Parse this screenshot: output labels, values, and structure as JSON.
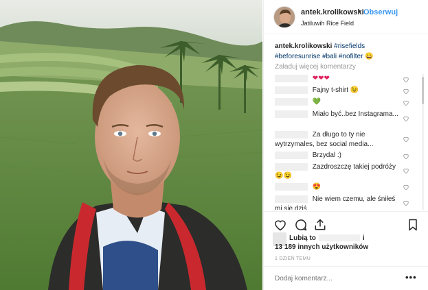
{
  "header": {
    "username": "antek.krolikowski",
    "dot": "•",
    "follow_label": "Obserwuj",
    "location": "Jatiluwih Rice Field"
  },
  "caption": {
    "username": "antek.krolikowski",
    "tag1": "#risefields",
    "tag2": "#beforesunrise",
    "tag3": "#bali",
    "tag4": "#nofilter",
    "emoji": "😀"
  },
  "load_more": "Załaduj więcej komentarzy",
  "comments": [
    {
      "text": "❤❤❤"
    },
    {
      "text": "Fajny t-shirt 😉"
    },
    {
      "text": "💚"
    },
    {
      "text": "Miało być..bez Instagrama..."
    },
    {
      "text": "Za długo to ty nie wytrzymales, bez social media..."
    },
    {
      "text": "Brzydal :)"
    },
    {
      "text": "Zazdroszczę takiej podróży"
    },
    {
      "text": "😉😉"
    },
    {
      "text": "😍"
    },
    {
      "text": "Nie wiem czemu, ale śniłeś mi się dziś"
    }
  ],
  "likes": {
    "prefix": "Lubią to",
    "suffix": "i",
    "line2": "13 189 innych użytkowników"
  },
  "date": "1 dzień temu",
  "add_comment_placeholder": "Dodaj komentarz...",
  "more_label": "•••",
  "icons": {
    "like": "heart-outline-icon",
    "comment": "comment-bubble-icon",
    "share": "share-arrow-icon",
    "save": "bookmark-icon",
    "comment_like": "small-heart-icon"
  }
}
